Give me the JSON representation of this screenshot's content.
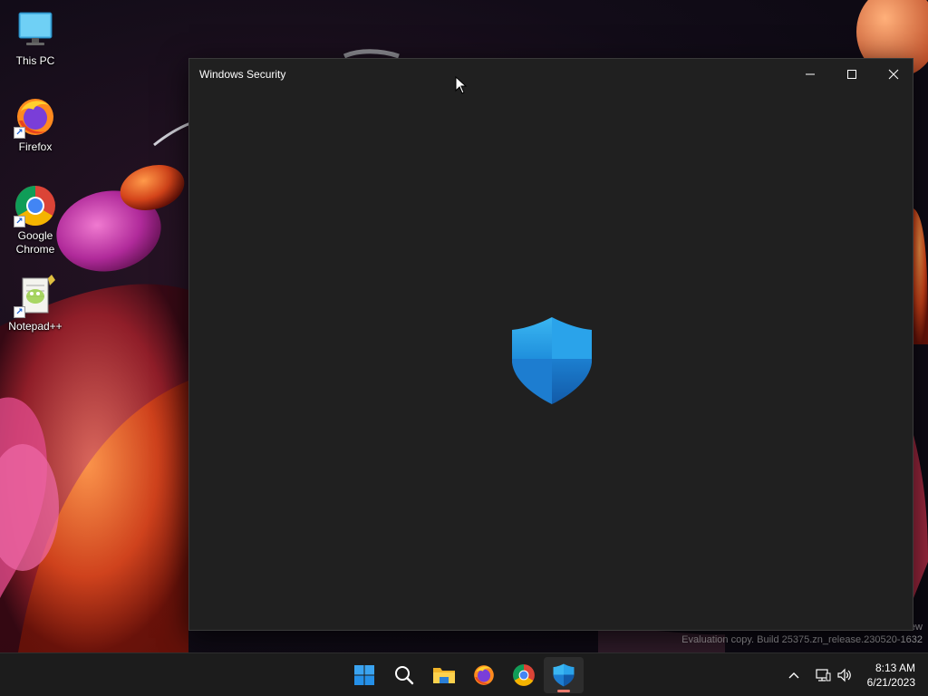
{
  "desktop": {
    "icons": [
      {
        "label": "This PC",
        "icon": "this-pc-icon"
      },
      {
        "label": "Firefox",
        "icon": "firefox-icon"
      },
      {
        "label": "Google Chrome",
        "icon": "chrome-icon"
      },
      {
        "label": "Notepad++",
        "icon": "notepad-plus-plus-icon"
      }
    ]
  },
  "window": {
    "title": "Windows Security",
    "controls": {
      "minimize": "minimize-icon",
      "maximize": "maximize-icon",
      "close": "close-icon"
    },
    "splash_icon": "windows-security-shield-icon"
  },
  "watermark": {
    "line1": "ew",
    "line2": "Evaluation copy. Build 25375.zn_release.230520-1632"
  },
  "taskbar": {
    "apps": [
      {
        "name": "Start",
        "icon": "windows-start-icon"
      },
      {
        "name": "Search",
        "icon": "search-icon"
      },
      {
        "name": "File Explorer",
        "icon": "file-explorer-icon"
      },
      {
        "name": "Firefox",
        "icon": "firefox-icon"
      },
      {
        "name": "Google Chrome",
        "icon": "chrome-icon"
      },
      {
        "name": "Windows Security",
        "icon": "windows-security-shield-icon",
        "active": true
      }
    ],
    "tray": {
      "overflow_icon": "chevron-up-icon",
      "network_icon": "network-icon",
      "volume_icon": "volume-icon",
      "time": "8:13 AM",
      "date": "6/21/2023"
    }
  },
  "colors": {
    "window_bg": "#202020",
    "taskbar_bg": "#1c1c1c",
    "shield_light": "#2ba8ec",
    "shield_dark": "#1a6fc0",
    "active_indicator": "#e97a6d"
  }
}
